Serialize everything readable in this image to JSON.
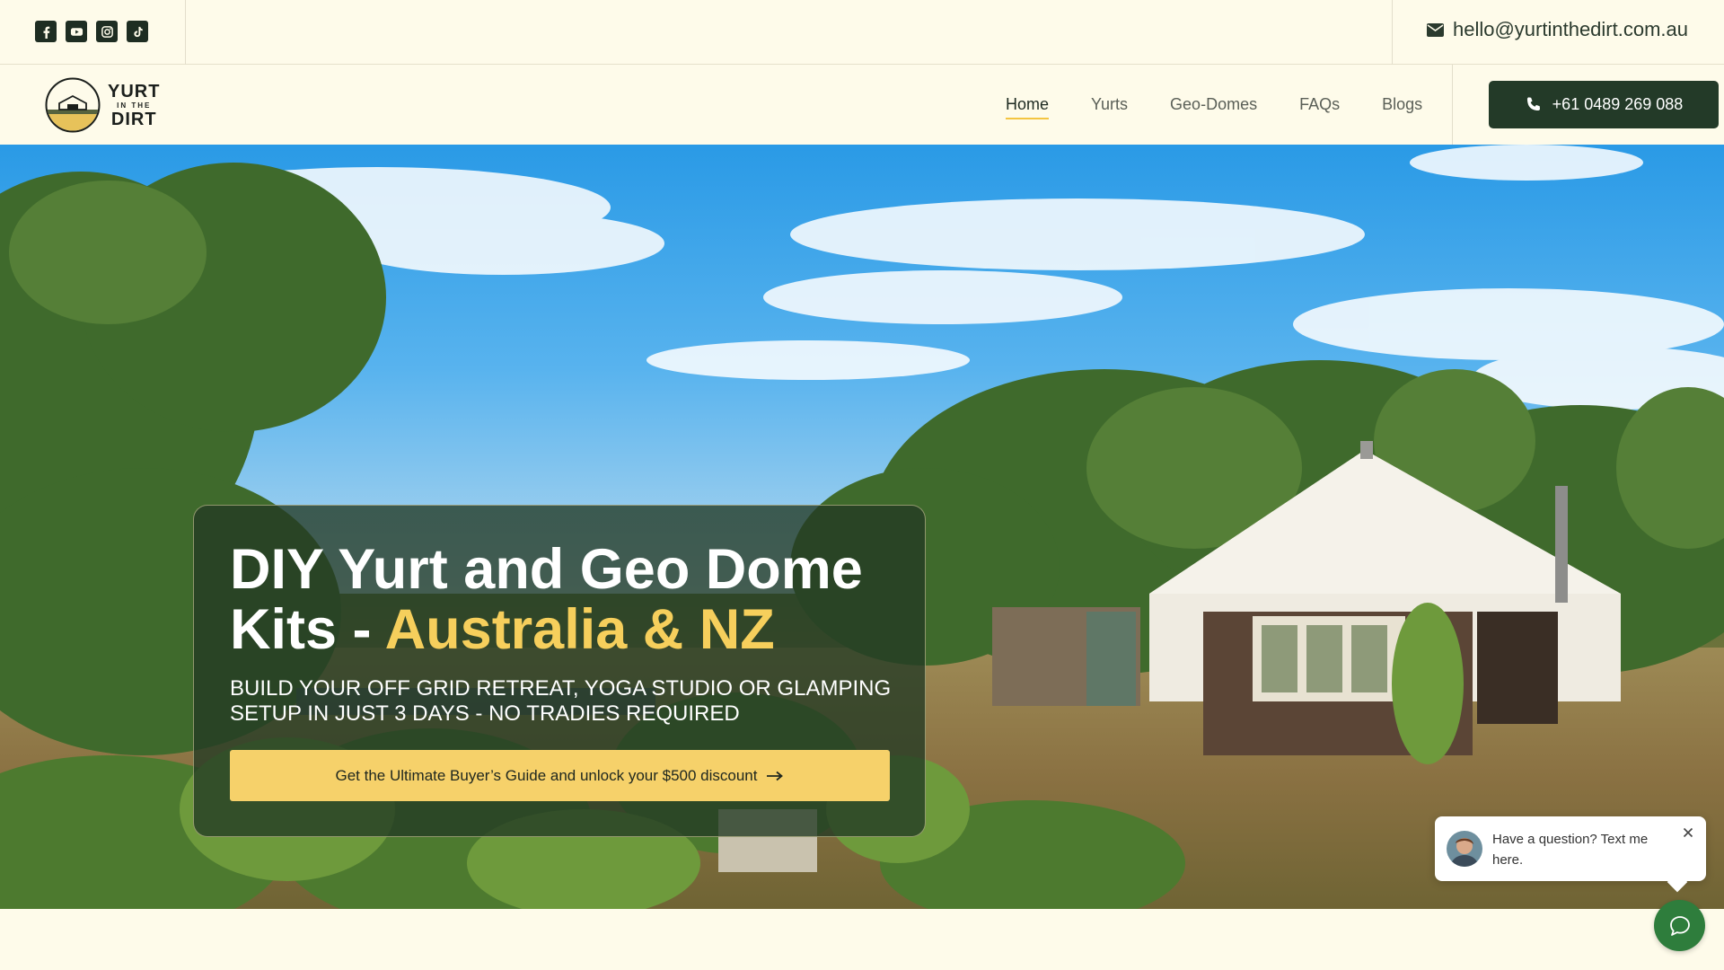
{
  "topbar": {
    "socials": [
      {
        "icon": "facebook-icon"
      },
      {
        "icon": "youtube-icon"
      },
      {
        "icon": "instagram-icon"
      },
      {
        "icon": "tiktok-icon"
      }
    ],
    "email": "hello@yurtinthedirt.com.au",
    "email_icon": "envelope-icon"
  },
  "logo": {
    "line1": "YURT",
    "line2": "IN THE",
    "line3": "DIRT"
  },
  "nav": {
    "items": [
      {
        "label": "Home",
        "active": true
      },
      {
        "label": "Yurts",
        "active": false
      },
      {
        "label": "Geo-Domes",
        "active": false
      },
      {
        "label": "FAQs",
        "active": false
      },
      {
        "label": "Blogs",
        "active": false
      }
    ],
    "phone": "+61 0489 269 088",
    "phone_icon": "phone-icon"
  },
  "hero": {
    "title_main": "DIY Yurt and Geo Dome Kits - ",
    "title_accent": "Australia & NZ",
    "subtitle": "BUILD YOUR OFF GRID RETREAT, YOGA STUDIO OR GLAMPING SETUP IN JUST 3 DAYS - NO TRADIES REQUIRED",
    "cta_label": "Get the Ultimate Buyer’s Guide and unlock your $500 discount",
    "cta_icon": "arrow-right-icon"
  },
  "chat": {
    "message": "Have a question? Text me here.",
    "close_icon": "close-icon",
    "fab_icon": "chat-bubble-icon"
  },
  "colors": {
    "background": "#fefbea",
    "primary_dark": "#233a28",
    "accent_yellow": "#f6d16a",
    "chat_green": "#2e7d3c"
  }
}
